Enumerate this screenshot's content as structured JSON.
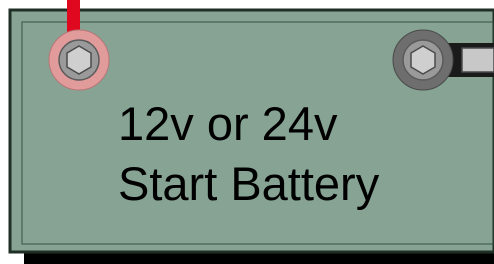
{
  "battery": {
    "label_line1": "12v or 24v",
    "label_line2": "Start Battery",
    "colors": {
      "body_fill": "#86a394",
      "body_outline": "#1f2f25",
      "shadow": "#000000",
      "positive_wire": "#e0081e",
      "positive_ring": "#e29b9b",
      "negative_ring": "#6e6e6e",
      "negative_cable": "#1a1a1a",
      "terminal_bolt": "#c8c8c8",
      "text": "#000000"
    },
    "terminals": {
      "positive": "positive-terminal",
      "negative": "negative-terminal"
    }
  }
}
